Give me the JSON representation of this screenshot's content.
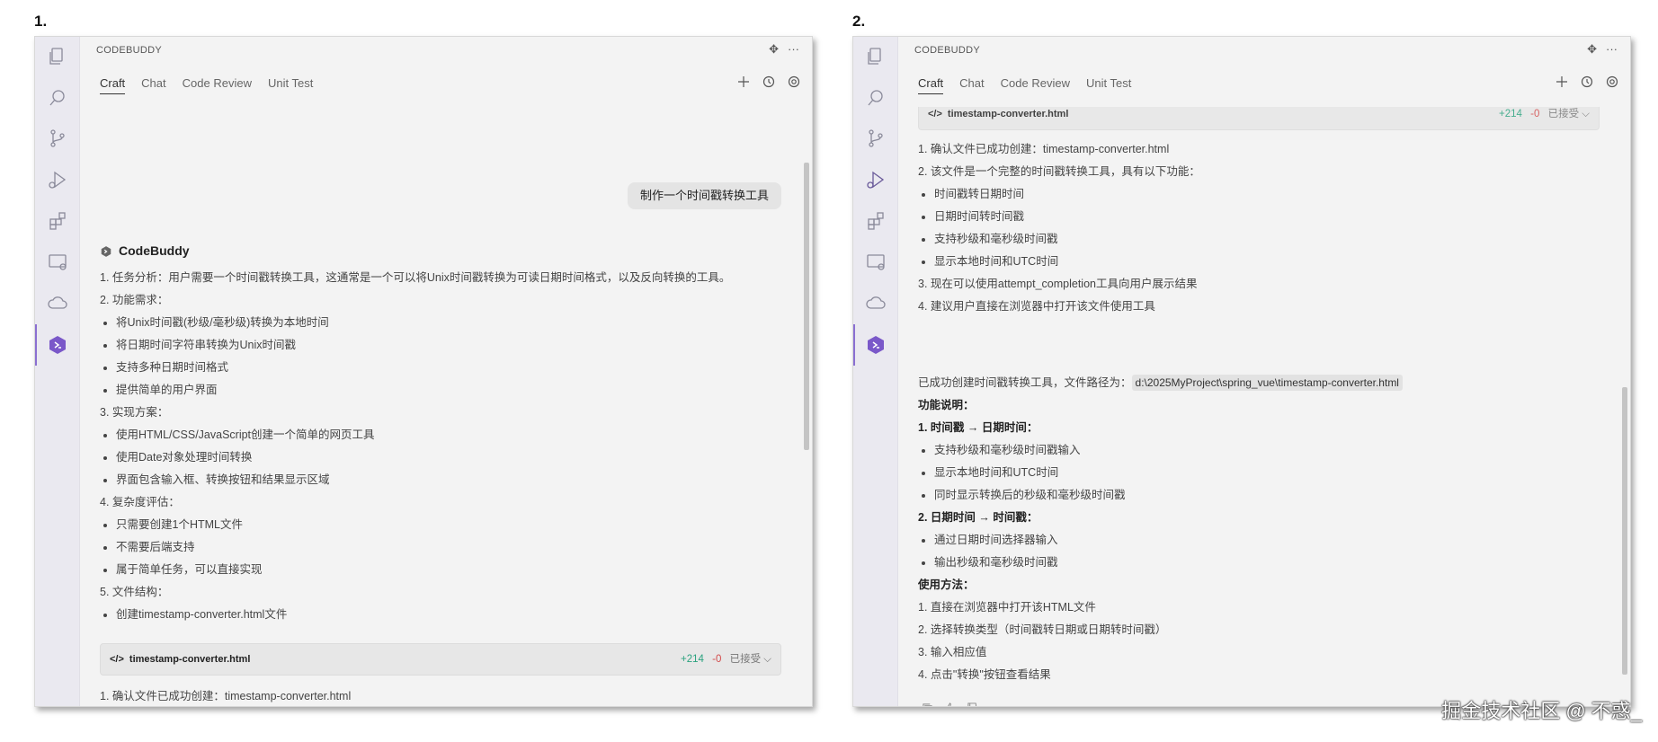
{
  "step1_label": "1.",
  "step2_label": "2.",
  "app_title": "CODEBUDDY",
  "tabs": [
    "Craft",
    "Chat",
    "Code Review",
    "Unit Test"
  ],
  "colors": {
    "accent": "#8a6fd1",
    "added": "#2aa27e",
    "removed": "#d34b4b"
  },
  "panel1": {
    "user_message": "制作一个时间戳转换工具",
    "bot_name": "CodeBuddy",
    "lines": [
      {
        "kind": "line",
        "text": "1. 任务分析：用户需要一个时间戳转换工具，这通常是一个可以将Unix时间戳转换为可读日期时间格式，以及反向转换的工具。"
      },
      {
        "kind": "line",
        "text": "2. 功能需求："
      },
      {
        "kind": "bullet",
        "text": "将Unix时间戳(秒级/毫秒级)转换为本地时间"
      },
      {
        "kind": "bullet",
        "text": "将日期时间字符串转换为Unix时间戳"
      },
      {
        "kind": "bullet",
        "text": "支持多种日期时间格式"
      },
      {
        "kind": "bullet",
        "text": "提供简单的用户界面"
      },
      {
        "kind": "line",
        "text": "3. 实现方案："
      },
      {
        "kind": "bullet",
        "text": "使用HTML/CSS/JavaScript创建一个简单的网页工具"
      },
      {
        "kind": "bullet",
        "text": "使用Date对象处理时间转换"
      },
      {
        "kind": "bullet",
        "text": "界面包含输入框、转换按钮和结果显示区域"
      },
      {
        "kind": "line",
        "text": "4. 复杂度评估："
      },
      {
        "kind": "bullet",
        "text": "只需要创建1个HTML文件"
      },
      {
        "kind": "bullet",
        "text": "不需要后端支持"
      },
      {
        "kind": "bullet",
        "text": "属于简单任务，可以直接实现"
      },
      {
        "kind": "line",
        "text": "5. 文件结构："
      },
      {
        "kind": "bullet",
        "text": "创建timestamp-converter.html文件"
      }
    ],
    "file_card": {
      "name": "timestamp-converter.html",
      "added": "+214",
      "removed": "-0",
      "status": "已接受"
    },
    "after_card": "1. 确认文件已成功创建：timestamp-converter.html"
  },
  "panel2": {
    "file_card": {
      "name": "timestamp-converter.html",
      "added": "+214",
      "removed": "-0",
      "status": "已接受"
    },
    "lines": [
      {
        "kind": "line",
        "text": "1. 确认文件已成功创建：timestamp-converter.html"
      },
      {
        "kind": "line",
        "text": "2. 该文件是一个完整的时间戳转换工具，具有以下功能："
      },
      {
        "kind": "bullet",
        "text": "时间戳转日期时间"
      },
      {
        "kind": "bullet",
        "text": "日期时间转时间戳"
      },
      {
        "kind": "bullet",
        "text": "支持秒级和毫秒级时间戳"
      },
      {
        "kind": "bullet",
        "text": "显示本地时间和UTC时间"
      },
      {
        "kind": "line",
        "text": "3. 现在可以使用attempt_completion工具向用户展示结果"
      },
      {
        "kind": "line",
        "text": "4. 建议用户直接在浏览器中打开该文件使用工具"
      }
    ],
    "summary_prefix": "已成功创建时间戳转换工具，文件路径为：",
    "summary_path": "d:\\2025MyProject\\spring_vue\\timestamp-converter.html",
    "lines2": [
      {
        "kind": "bold",
        "text": "功能说明："
      },
      {
        "kind": "bold",
        "text": "1. 时间戳 → 日期时间："
      },
      {
        "kind": "bullet",
        "text": "支持秒级和毫秒级时间戳输入"
      },
      {
        "kind": "bullet",
        "text": "显示本地时间和UTC时间"
      },
      {
        "kind": "bullet",
        "text": "同时显示转换后的秒级和毫秒级时间戳"
      },
      {
        "kind": "bold",
        "text": "2. 日期时间 → 时间戳："
      },
      {
        "kind": "bullet",
        "text": "通过日期时间选择器输入"
      },
      {
        "kind": "bullet",
        "text": "输出秒级和毫秒级时间戳"
      },
      {
        "kind": "bold",
        "text": "使用方法："
      },
      {
        "kind": "line",
        "text": "1. 直接在浏览器中打开该HTML文件"
      },
      {
        "kind": "line",
        "text": "2. 选择转换类型（时间戳转日期或日期转时间戳）"
      },
      {
        "kind": "line",
        "text": "3. 输入相应值"
      },
      {
        "kind": "line",
        "text": "4. 点击\"转换\"按钮查看结果"
      }
    ]
  },
  "watermark": "掘金技术社区 @ 不惑_"
}
